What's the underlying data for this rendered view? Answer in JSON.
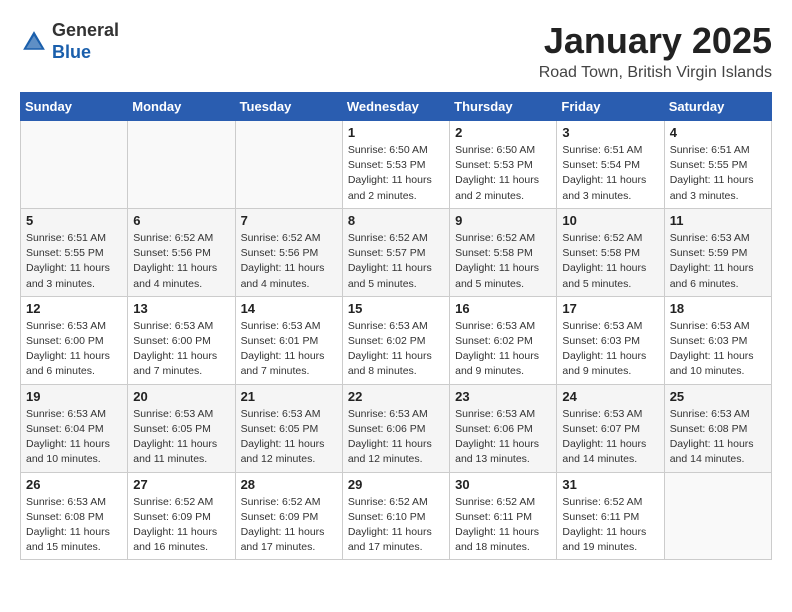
{
  "header": {
    "logo_general": "General",
    "logo_blue": "Blue",
    "month": "January 2025",
    "location": "Road Town, British Virgin Islands"
  },
  "weekdays": [
    "Sunday",
    "Monday",
    "Tuesday",
    "Wednesday",
    "Thursday",
    "Friday",
    "Saturday"
  ],
  "weeks": [
    [
      {
        "day": "",
        "info": ""
      },
      {
        "day": "",
        "info": ""
      },
      {
        "day": "",
        "info": ""
      },
      {
        "day": "1",
        "info": "Sunrise: 6:50 AM\nSunset: 5:53 PM\nDaylight: 11 hours and 2 minutes."
      },
      {
        "day": "2",
        "info": "Sunrise: 6:50 AM\nSunset: 5:53 PM\nDaylight: 11 hours and 2 minutes."
      },
      {
        "day": "3",
        "info": "Sunrise: 6:51 AM\nSunset: 5:54 PM\nDaylight: 11 hours and 3 minutes."
      },
      {
        "day": "4",
        "info": "Sunrise: 6:51 AM\nSunset: 5:55 PM\nDaylight: 11 hours and 3 minutes."
      }
    ],
    [
      {
        "day": "5",
        "info": "Sunrise: 6:51 AM\nSunset: 5:55 PM\nDaylight: 11 hours and 3 minutes."
      },
      {
        "day": "6",
        "info": "Sunrise: 6:52 AM\nSunset: 5:56 PM\nDaylight: 11 hours and 4 minutes."
      },
      {
        "day": "7",
        "info": "Sunrise: 6:52 AM\nSunset: 5:56 PM\nDaylight: 11 hours and 4 minutes."
      },
      {
        "day": "8",
        "info": "Sunrise: 6:52 AM\nSunset: 5:57 PM\nDaylight: 11 hours and 5 minutes."
      },
      {
        "day": "9",
        "info": "Sunrise: 6:52 AM\nSunset: 5:58 PM\nDaylight: 11 hours and 5 minutes."
      },
      {
        "day": "10",
        "info": "Sunrise: 6:52 AM\nSunset: 5:58 PM\nDaylight: 11 hours and 5 minutes."
      },
      {
        "day": "11",
        "info": "Sunrise: 6:53 AM\nSunset: 5:59 PM\nDaylight: 11 hours and 6 minutes."
      }
    ],
    [
      {
        "day": "12",
        "info": "Sunrise: 6:53 AM\nSunset: 6:00 PM\nDaylight: 11 hours and 6 minutes."
      },
      {
        "day": "13",
        "info": "Sunrise: 6:53 AM\nSunset: 6:00 PM\nDaylight: 11 hours and 7 minutes."
      },
      {
        "day": "14",
        "info": "Sunrise: 6:53 AM\nSunset: 6:01 PM\nDaylight: 11 hours and 7 minutes."
      },
      {
        "day": "15",
        "info": "Sunrise: 6:53 AM\nSunset: 6:02 PM\nDaylight: 11 hours and 8 minutes."
      },
      {
        "day": "16",
        "info": "Sunrise: 6:53 AM\nSunset: 6:02 PM\nDaylight: 11 hours and 9 minutes."
      },
      {
        "day": "17",
        "info": "Sunrise: 6:53 AM\nSunset: 6:03 PM\nDaylight: 11 hours and 9 minutes."
      },
      {
        "day": "18",
        "info": "Sunrise: 6:53 AM\nSunset: 6:03 PM\nDaylight: 11 hours and 10 minutes."
      }
    ],
    [
      {
        "day": "19",
        "info": "Sunrise: 6:53 AM\nSunset: 6:04 PM\nDaylight: 11 hours and 10 minutes."
      },
      {
        "day": "20",
        "info": "Sunrise: 6:53 AM\nSunset: 6:05 PM\nDaylight: 11 hours and 11 minutes."
      },
      {
        "day": "21",
        "info": "Sunrise: 6:53 AM\nSunset: 6:05 PM\nDaylight: 11 hours and 12 minutes."
      },
      {
        "day": "22",
        "info": "Sunrise: 6:53 AM\nSunset: 6:06 PM\nDaylight: 11 hours and 12 minutes."
      },
      {
        "day": "23",
        "info": "Sunrise: 6:53 AM\nSunset: 6:06 PM\nDaylight: 11 hours and 13 minutes."
      },
      {
        "day": "24",
        "info": "Sunrise: 6:53 AM\nSunset: 6:07 PM\nDaylight: 11 hours and 14 minutes."
      },
      {
        "day": "25",
        "info": "Sunrise: 6:53 AM\nSunset: 6:08 PM\nDaylight: 11 hours and 14 minutes."
      }
    ],
    [
      {
        "day": "26",
        "info": "Sunrise: 6:53 AM\nSunset: 6:08 PM\nDaylight: 11 hours and 15 minutes."
      },
      {
        "day": "27",
        "info": "Sunrise: 6:52 AM\nSunset: 6:09 PM\nDaylight: 11 hours and 16 minutes."
      },
      {
        "day": "28",
        "info": "Sunrise: 6:52 AM\nSunset: 6:09 PM\nDaylight: 11 hours and 17 minutes."
      },
      {
        "day": "29",
        "info": "Sunrise: 6:52 AM\nSunset: 6:10 PM\nDaylight: 11 hours and 17 minutes."
      },
      {
        "day": "30",
        "info": "Sunrise: 6:52 AM\nSunset: 6:11 PM\nDaylight: 11 hours and 18 minutes."
      },
      {
        "day": "31",
        "info": "Sunrise: 6:52 AM\nSunset: 6:11 PM\nDaylight: 11 hours and 19 minutes."
      },
      {
        "day": "",
        "info": ""
      }
    ]
  ]
}
